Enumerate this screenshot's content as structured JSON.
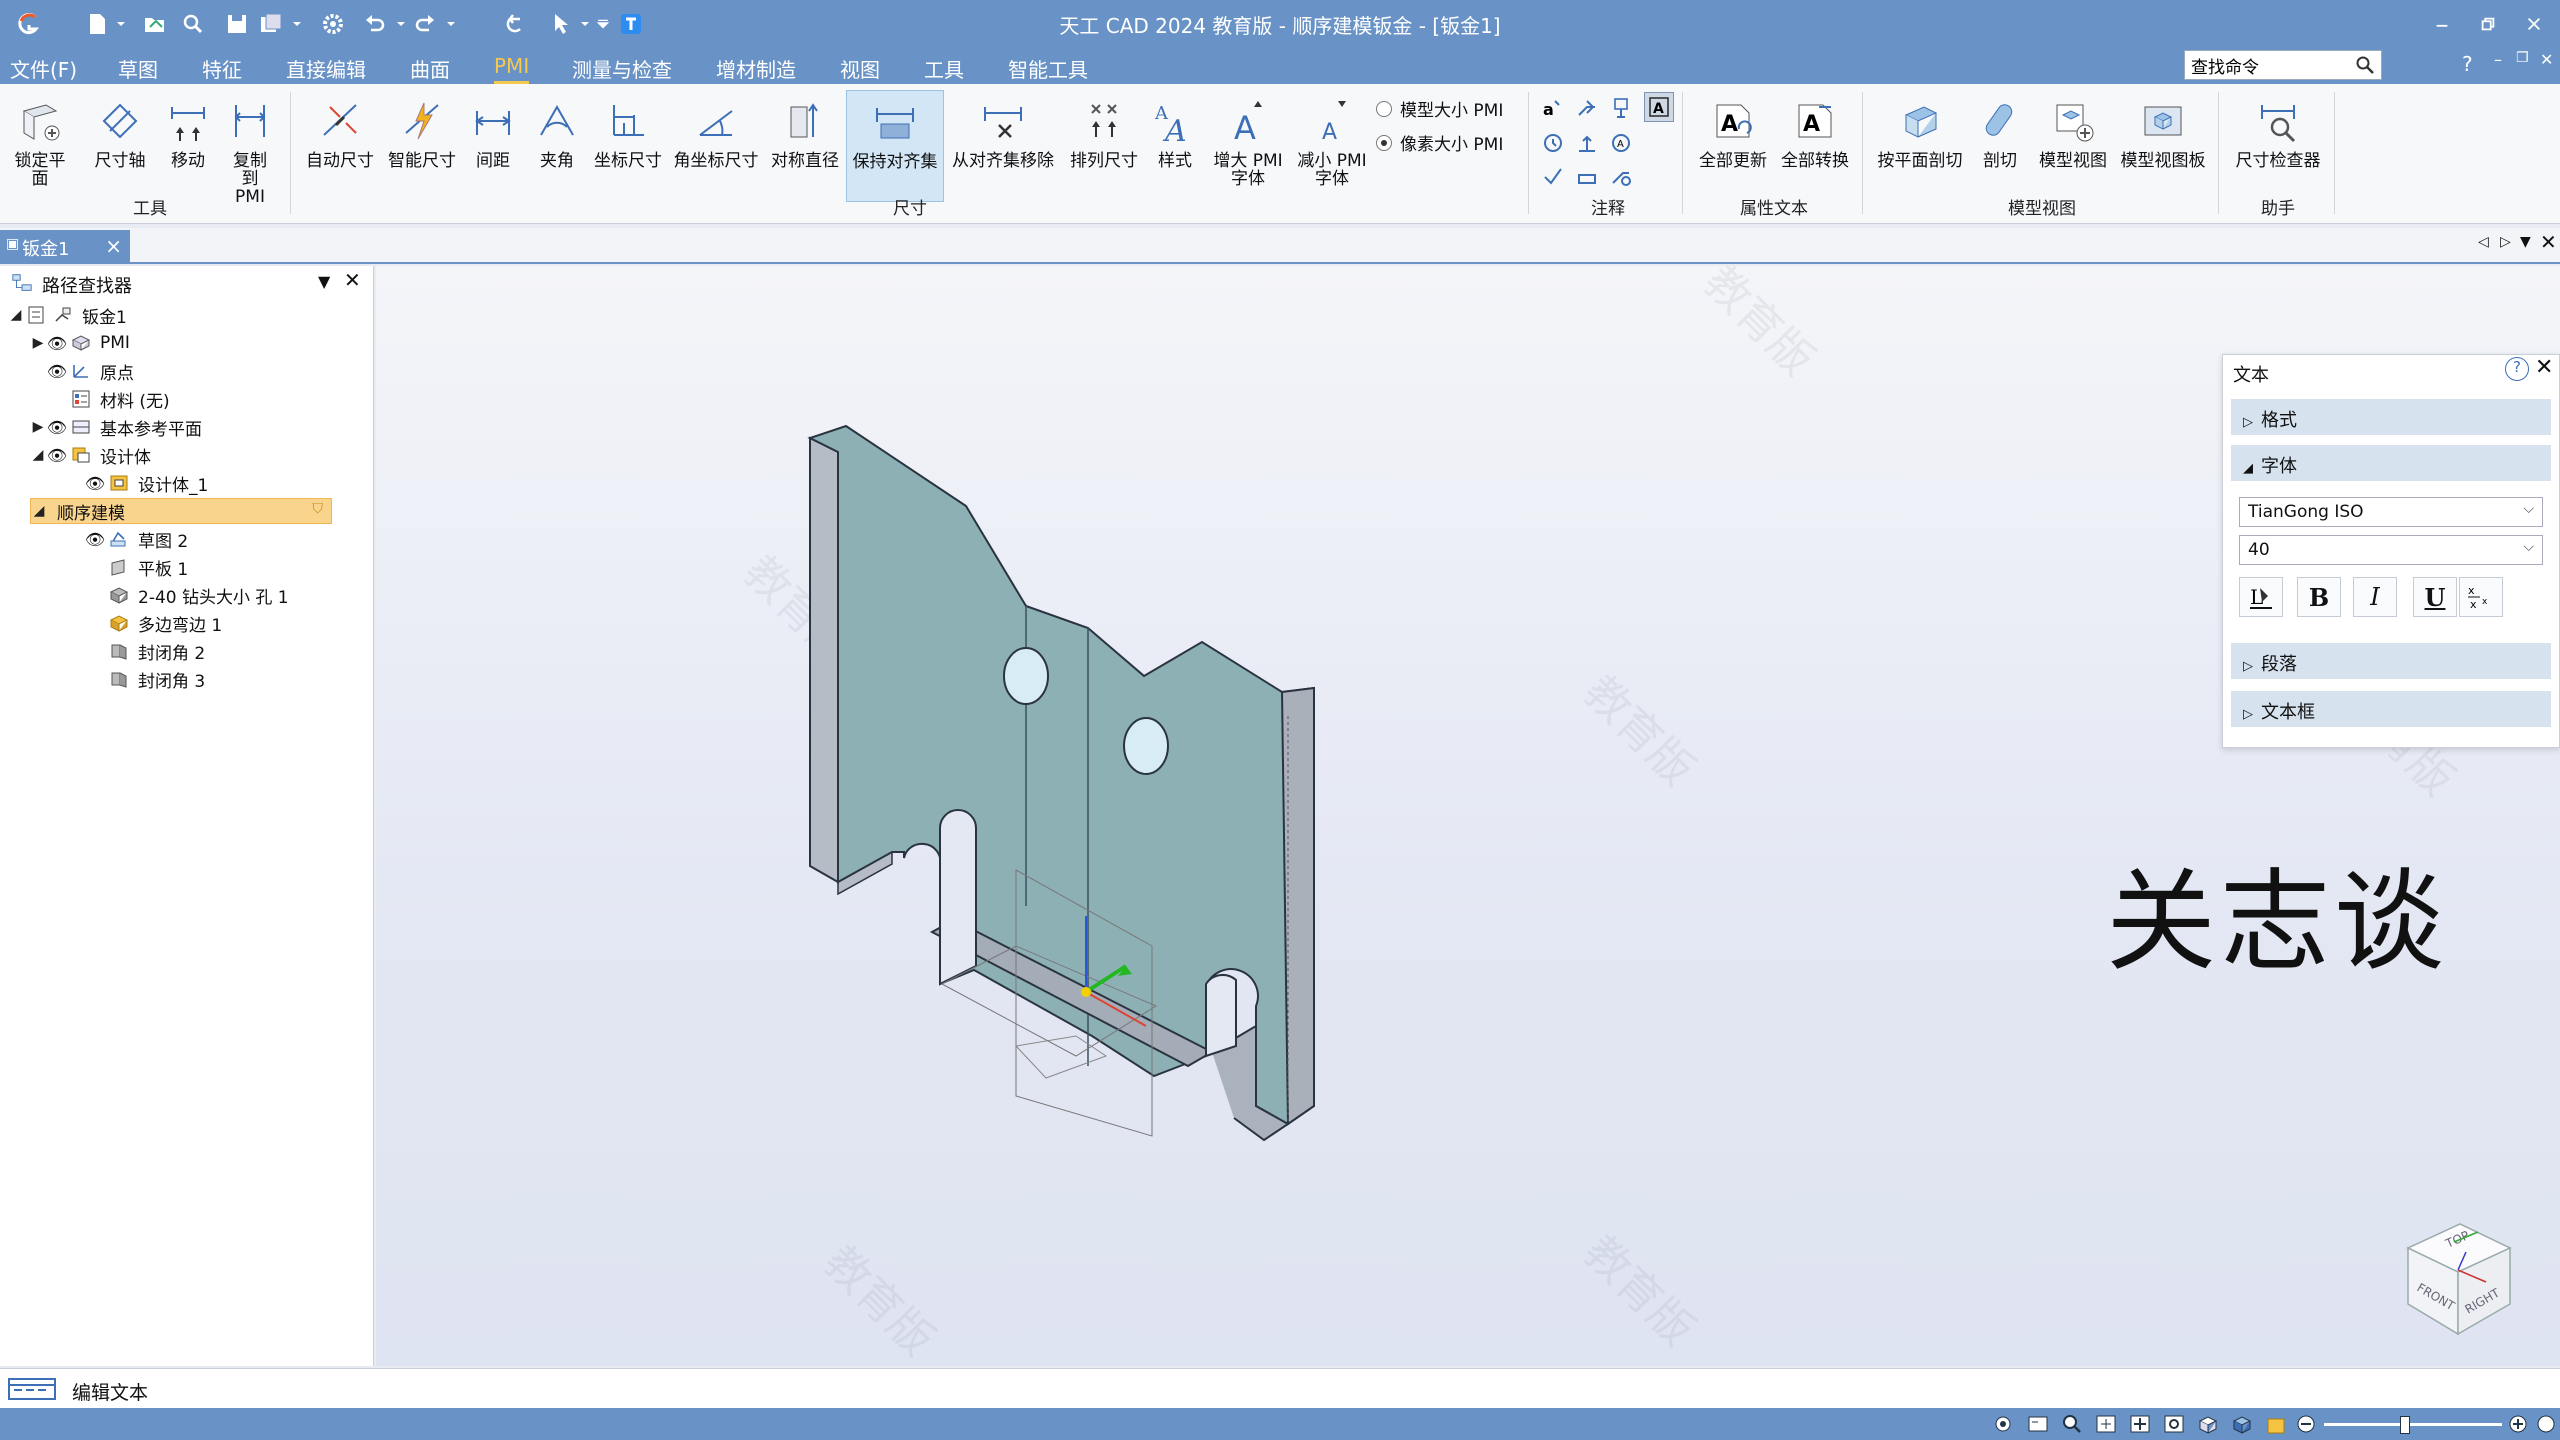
{
  "app": {
    "title": "天工 CAD 2024 教育版 - 顺序建模钣金 - [钣金1]"
  },
  "menu": {
    "items": [
      "文件(F)",
      "草图",
      "特征",
      "直接编辑",
      "曲面",
      "PMI",
      "测量与检查",
      "增材制造",
      "视图",
      "工具",
      "智能工具"
    ],
    "active": "PMI",
    "search_placeholder": "查找命令",
    "help": "?"
  },
  "ribbon": {
    "tools": {
      "label": "工具",
      "buttons": [
        "锁定平面",
        "尺寸轴",
        "移动",
        "复制到PMI"
      ]
    },
    "dimension": {
      "label": "尺寸",
      "buttons": [
        "自动尺寸",
        "智能尺寸",
        "间距",
        "夹角",
        "坐标尺寸",
        "角坐标尺寸",
        "对称直径",
        "保持对齐集",
        "从对齐集移除",
        "排列尺寸",
        "样式",
        "增大 PMI 字体",
        "减小 PMI 字体"
      ],
      "selected": "保持对齐集"
    },
    "pmi_size": {
      "model": "模型大小 PMI",
      "pixel": "像素大小 PMI",
      "selected": "像素大小 PMI"
    },
    "annotation": {
      "label": "注释"
    },
    "attr_text": {
      "label": "属性文本",
      "buttons": [
        "全部更新",
        "全部转换"
      ]
    },
    "model_view": {
      "label": "模型视图",
      "buttons": [
        "按平面剖切",
        "剖切",
        "模型视图",
        "模型视图板"
      ]
    },
    "assistant": {
      "label": "助手",
      "buttons": [
        "尺寸检查器"
      ]
    }
  },
  "doc_tab": {
    "label": "钣金1"
  },
  "pathfinder": {
    "title": "路径查找器",
    "tree": [
      {
        "label": "钣金1"
      },
      {
        "label": "PMI"
      },
      {
        "label": "原点"
      },
      {
        "label": "材料 (无)"
      },
      {
        "label": "基本参考平面"
      },
      {
        "label": "设计体"
      },
      {
        "label": "设计体_1"
      },
      {
        "label": "顺序建模"
      },
      {
        "label": "草图 2"
      },
      {
        "label": "平板 1"
      },
      {
        "label": "2-40 钻头大小 孔 1"
      },
      {
        "label": "多边弯边 1"
      },
      {
        "label": "封闭角 2"
      },
      {
        "label": "封闭角 3"
      }
    ]
  },
  "viewport": {
    "placed_text": "关志谈",
    "watermark": "教育版",
    "cube_faces": [
      "TOP",
      "FRONT",
      "RIGHT"
    ]
  },
  "text_panel": {
    "title": "文本",
    "sections": [
      "格式",
      "字体",
      "段落",
      "文本框"
    ],
    "font_name": "TianGong ISO",
    "font_size": "40"
  },
  "command_bar": {
    "text": "编辑文本"
  },
  "colors": {
    "titlebar": "#6993c6",
    "part_face": "#8db0b5",
    "part_side": "#a9b0ba",
    "menu_active": "#f4c94e"
  }
}
